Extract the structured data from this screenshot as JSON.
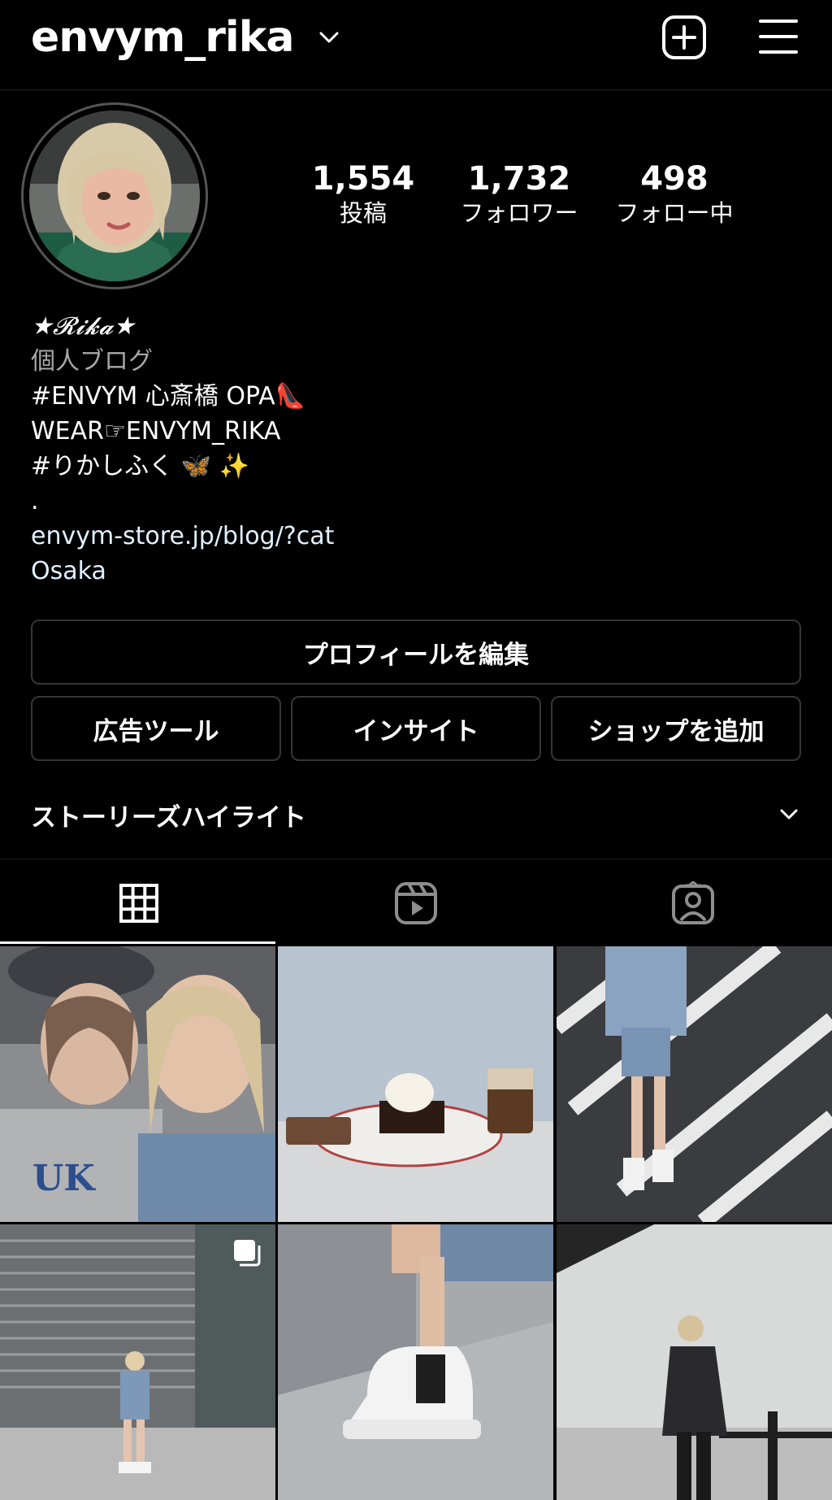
{
  "header": {
    "username": "envym_rika",
    "chevron_icon": "chevron-down-icon",
    "new_post_icon": "plus-square-icon",
    "menu_icon": "hamburger-menu-icon"
  },
  "profile": {
    "stats": [
      {
        "number": "1,554",
        "label": "投稿"
      },
      {
        "number": "1,732",
        "label": "フォロワー"
      },
      {
        "number": "498",
        "label": "フォロー中"
      }
    ],
    "bio": {
      "name": "★𝓡𝓲𝓴𝓪★",
      "category": "個人ブログ",
      "lines": [
        "#ENVYM 心斎橋 OPA👠",
        "WEAR☞ENVYM_RIKA",
        "#りかしふく 🦋 ✨",
        "."
      ],
      "link": "envym-store.jp/blog/?cat",
      "location": "Osaka"
    }
  },
  "buttons": {
    "edit_profile": "プロフィールを編集",
    "ad_tools": "広告ツール",
    "insights": "インサイト",
    "add_shop": "ショップを追加"
  },
  "highlights": {
    "label": "ストーリーズハイライト"
  },
  "tabs": [
    "grid-icon",
    "reels-icon",
    "tagged-icon"
  ],
  "colors": {
    "background": "#000000",
    "text": "#ffffff",
    "secondary_text": "#a8a8a8",
    "link_text": "#e0f1ff",
    "border": "#363636"
  }
}
